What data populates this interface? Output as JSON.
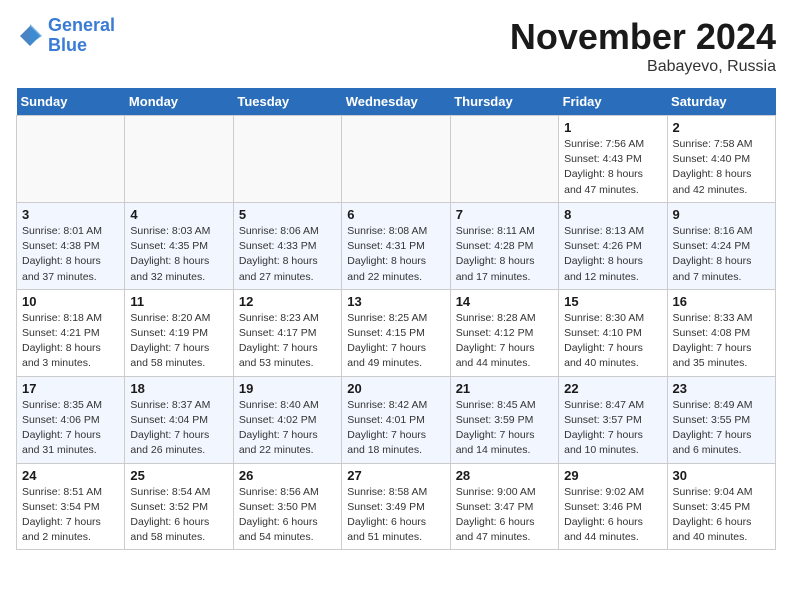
{
  "header": {
    "logo_line1": "General",
    "logo_line2": "Blue",
    "month": "November 2024",
    "location": "Babayevo, Russia"
  },
  "weekdays": [
    "Sunday",
    "Monday",
    "Tuesday",
    "Wednesday",
    "Thursday",
    "Friday",
    "Saturday"
  ],
  "weeks": [
    [
      {
        "day": "",
        "info": ""
      },
      {
        "day": "",
        "info": ""
      },
      {
        "day": "",
        "info": ""
      },
      {
        "day": "",
        "info": ""
      },
      {
        "day": "",
        "info": ""
      },
      {
        "day": "1",
        "info": "Sunrise: 7:56 AM\nSunset: 4:43 PM\nDaylight: 8 hours\nand 47 minutes."
      },
      {
        "day": "2",
        "info": "Sunrise: 7:58 AM\nSunset: 4:40 PM\nDaylight: 8 hours\nand 42 minutes."
      }
    ],
    [
      {
        "day": "3",
        "info": "Sunrise: 8:01 AM\nSunset: 4:38 PM\nDaylight: 8 hours\nand 37 minutes."
      },
      {
        "day": "4",
        "info": "Sunrise: 8:03 AM\nSunset: 4:35 PM\nDaylight: 8 hours\nand 32 minutes."
      },
      {
        "day": "5",
        "info": "Sunrise: 8:06 AM\nSunset: 4:33 PM\nDaylight: 8 hours\nand 27 minutes."
      },
      {
        "day": "6",
        "info": "Sunrise: 8:08 AM\nSunset: 4:31 PM\nDaylight: 8 hours\nand 22 minutes."
      },
      {
        "day": "7",
        "info": "Sunrise: 8:11 AM\nSunset: 4:28 PM\nDaylight: 8 hours\nand 17 minutes."
      },
      {
        "day": "8",
        "info": "Sunrise: 8:13 AM\nSunset: 4:26 PM\nDaylight: 8 hours\nand 12 minutes."
      },
      {
        "day": "9",
        "info": "Sunrise: 8:16 AM\nSunset: 4:24 PM\nDaylight: 8 hours\nand 7 minutes."
      }
    ],
    [
      {
        "day": "10",
        "info": "Sunrise: 8:18 AM\nSunset: 4:21 PM\nDaylight: 8 hours\nand 3 minutes."
      },
      {
        "day": "11",
        "info": "Sunrise: 8:20 AM\nSunset: 4:19 PM\nDaylight: 7 hours\nand 58 minutes."
      },
      {
        "day": "12",
        "info": "Sunrise: 8:23 AM\nSunset: 4:17 PM\nDaylight: 7 hours\nand 53 minutes."
      },
      {
        "day": "13",
        "info": "Sunrise: 8:25 AM\nSunset: 4:15 PM\nDaylight: 7 hours\nand 49 minutes."
      },
      {
        "day": "14",
        "info": "Sunrise: 8:28 AM\nSunset: 4:12 PM\nDaylight: 7 hours\nand 44 minutes."
      },
      {
        "day": "15",
        "info": "Sunrise: 8:30 AM\nSunset: 4:10 PM\nDaylight: 7 hours\nand 40 minutes."
      },
      {
        "day": "16",
        "info": "Sunrise: 8:33 AM\nSunset: 4:08 PM\nDaylight: 7 hours\nand 35 minutes."
      }
    ],
    [
      {
        "day": "17",
        "info": "Sunrise: 8:35 AM\nSunset: 4:06 PM\nDaylight: 7 hours\nand 31 minutes."
      },
      {
        "day": "18",
        "info": "Sunrise: 8:37 AM\nSunset: 4:04 PM\nDaylight: 7 hours\nand 26 minutes."
      },
      {
        "day": "19",
        "info": "Sunrise: 8:40 AM\nSunset: 4:02 PM\nDaylight: 7 hours\nand 22 minutes."
      },
      {
        "day": "20",
        "info": "Sunrise: 8:42 AM\nSunset: 4:01 PM\nDaylight: 7 hours\nand 18 minutes."
      },
      {
        "day": "21",
        "info": "Sunrise: 8:45 AM\nSunset: 3:59 PM\nDaylight: 7 hours\nand 14 minutes."
      },
      {
        "day": "22",
        "info": "Sunrise: 8:47 AM\nSunset: 3:57 PM\nDaylight: 7 hours\nand 10 minutes."
      },
      {
        "day": "23",
        "info": "Sunrise: 8:49 AM\nSunset: 3:55 PM\nDaylight: 7 hours\nand 6 minutes."
      }
    ],
    [
      {
        "day": "24",
        "info": "Sunrise: 8:51 AM\nSunset: 3:54 PM\nDaylight: 7 hours\nand 2 minutes."
      },
      {
        "day": "25",
        "info": "Sunrise: 8:54 AM\nSunset: 3:52 PM\nDaylight: 6 hours\nand 58 minutes."
      },
      {
        "day": "26",
        "info": "Sunrise: 8:56 AM\nSunset: 3:50 PM\nDaylight: 6 hours\nand 54 minutes."
      },
      {
        "day": "27",
        "info": "Sunrise: 8:58 AM\nSunset: 3:49 PM\nDaylight: 6 hours\nand 51 minutes."
      },
      {
        "day": "28",
        "info": "Sunrise: 9:00 AM\nSunset: 3:47 PM\nDaylight: 6 hours\nand 47 minutes."
      },
      {
        "day": "29",
        "info": "Sunrise: 9:02 AM\nSunset: 3:46 PM\nDaylight: 6 hours\nand 44 minutes."
      },
      {
        "day": "30",
        "info": "Sunrise: 9:04 AM\nSunset: 3:45 PM\nDaylight: 6 hours\nand 40 minutes."
      }
    ]
  ]
}
